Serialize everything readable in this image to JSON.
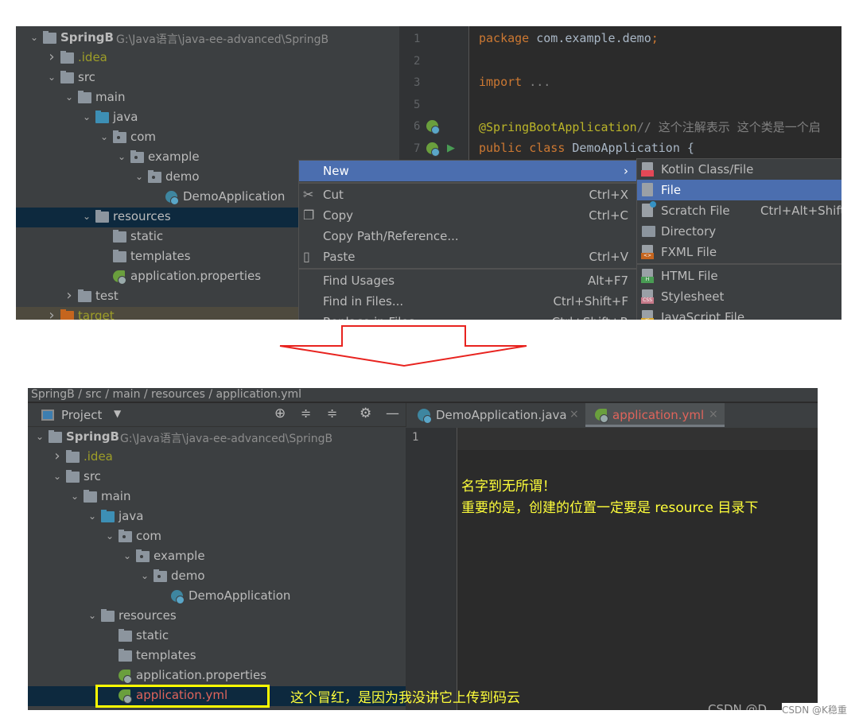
{
  "top": {
    "tree": [
      {
        "level": 0,
        "arrow": "down",
        "icon": "module",
        "label": "SpringB",
        "bold": true,
        "path": "G:\\Java语言\\java-ee-advanced\\SpringB"
      },
      {
        "level": 1,
        "arrow": "right",
        "icon": "folder",
        "label": ".idea",
        "color": "#9e9e28"
      },
      {
        "level": 1,
        "arrow": "down",
        "icon": "folder",
        "label": "src"
      },
      {
        "level": 2,
        "arrow": "down",
        "icon": "folder",
        "label": "main"
      },
      {
        "level": 3,
        "arrow": "down",
        "icon": "folder-source",
        "label": "java"
      },
      {
        "level": 4,
        "arrow": "down",
        "icon": "package",
        "label": "com"
      },
      {
        "level": 5,
        "arrow": "down",
        "icon": "package",
        "label": "example"
      },
      {
        "level": 6,
        "arrow": "down",
        "icon": "package",
        "label": "demo"
      },
      {
        "level": 7,
        "arrow": "",
        "icon": "spring-class",
        "label": "DemoApplication"
      },
      {
        "level": 3,
        "arrow": "down",
        "icon": "folder-resources",
        "label": "resources",
        "selected": true
      },
      {
        "level": 4,
        "arrow": "",
        "icon": "folder",
        "label": "static"
      },
      {
        "level": 4,
        "arrow": "",
        "icon": "folder",
        "label": "templates"
      },
      {
        "level": 4,
        "arrow": "",
        "icon": "spring-config",
        "label": "application.properties"
      },
      {
        "level": 2,
        "arrow": "right",
        "icon": "folder",
        "label": "test"
      },
      {
        "level": 1,
        "arrow": "right",
        "icon": "folder-excluded",
        "label": "target",
        "color": "#9e9e28",
        "excluded": true
      }
    ],
    "code": [
      {
        "n": "1",
        "parts": [
          [
            "kw",
            "package "
          ],
          [
            "",
            "com.example.demo"
          ],
          [
            "kw",
            ";"
          ]
        ]
      },
      {
        "n": "2",
        "parts": []
      },
      {
        "n": "3",
        "parts": [
          [
            "kw",
            "import "
          ],
          [
            "cm",
            "..."
          ]
        ]
      },
      {
        "n": "5",
        "parts": []
      },
      {
        "n": "6",
        "parts": [
          [
            "ann",
            "@SpringBootApplication"
          ],
          [
            "cm",
            "// 这个注解表示 这个类是一个启"
          ]
        ]
      },
      {
        "n": "7",
        "parts": [
          [
            "kw",
            "public class "
          ],
          [
            "",
            "DemoApplication {"
          ]
        ]
      }
    ],
    "menu": [
      {
        "label": "New",
        "shortcut": "",
        "highlighted": true,
        "submenu": true
      },
      {
        "sep": true
      },
      {
        "label": "Cut",
        "shortcut": "Ctrl+X",
        "icon": "scissors-icon"
      },
      {
        "label": "Copy",
        "shortcut": "Ctrl+C",
        "icon": "copy-icon"
      },
      {
        "label": "Copy Path/Reference...",
        "shortcut": ""
      },
      {
        "label": "Paste",
        "shortcut": "Ctrl+V",
        "icon": "paste-icon"
      },
      {
        "sep": true
      },
      {
        "label": "Find Usages",
        "shortcut": "Alt+F7"
      },
      {
        "label": "Find in Files...",
        "shortcut": "Ctrl+Shift+F"
      },
      {
        "label": "Replace in Files...",
        "shortcut": "Ctrl+Shift+R"
      }
    ],
    "submenu": [
      {
        "label": "Kotlin Class/File",
        "icon": "kotlin",
        "badge_color": "#e44857"
      },
      {
        "label": "File",
        "icon": "file",
        "highlighted": true
      },
      {
        "label": "Scratch File",
        "icon": "scratch",
        "shortcut": "Ctrl+Alt+Shift+Insert"
      },
      {
        "label": "Directory",
        "icon": "directory"
      },
      {
        "label": "FXML File",
        "icon": "fxml",
        "badge": "<>",
        "badge_color": "#c5651e"
      },
      {
        "sep": true
      },
      {
        "label": "HTML File",
        "icon": "html",
        "badge": "H",
        "badge_color": "#499c54"
      },
      {
        "label": "Stylesheet",
        "icon": "css",
        "badge": "CSS",
        "badge_color": "#c77a8a"
      },
      {
        "label": "JavaScript File",
        "icon": "js",
        "badge": "JS",
        "badge_color": "#d6a32a"
      }
    ]
  },
  "bottom": {
    "breadcrumb": "SpringB / src / main / resources / application.yml",
    "project_label": "Project",
    "tabs": [
      {
        "label": "DemoApplication.java",
        "color": "#bbbbbb"
      },
      {
        "label": "application.yml",
        "color": "#e0645b",
        "active": true
      }
    ],
    "tree": [
      {
        "level": 0,
        "arrow": "down",
        "icon": "module",
        "label": "SpringB",
        "bold": true,
        "path": "G:\\Java语言\\java-ee-advanced\\SpringB"
      },
      {
        "level": 1,
        "arrow": "right",
        "icon": "folder",
        "label": ".idea",
        "color": "#9e9e28"
      },
      {
        "level": 1,
        "arrow": "down",
        "icon": "folder",
        "label": "src"
      },
      {
        "level": 2,
        "arrow": "down",
        "icon": "folder",
        "label": "main"
      },
      {
        "level": 3,
        "arrow": "down",
        "icon": "folder-source",
        "label": "java"
      },
      {
        "level": 4,
        "arrow": "down",
        "icon": "package",
        "label": "com"
      },
      {
        "level": 5,
        "arrow": "down",
        "icon": "package",
        "label": "example"
      },
      {
        "level": 6,
        "arrow": "down",
        "icon": "package",
        "label": "demo"
      },
      {
        "level": 7,
        "arrow": "",
        "icon": "spring-class",
        "label": "DemoApplication"
      },
      {
        "level": 3,
        "arrow": "down",
        "icon": "folder-resources",
        "label": "resources"
      },
      {
        "level": 4,
        "arrow": "",
        "icon": "folder",
        "label": "static"
      },
      {
        "level": 4,
        "arrow": "",
        "icon": "folder",
        "label": "templates"
      },
      {
        "level": 4,
        "arrow": "",
        "icon": "spring-config",
        "label": "application.properties"
      },
      {
        "level": 4,
        "arrow": "",
        "icon": "spring-config",
        "label": "application.yml",
        "color": "#e0645b",
        "selected": true
      }
    ],
    "line_number": "1",
    "note_line1": "名字到无所谓！",
    "note_line2": "重要的是，创建的位置一定要是 resource 目录下",
    "red_note": "这个冒红，是因为我没讲它上传到码云",
    "watermark": "CSDN @K稳重",
    "watermark_hidden": "CSDN @D"
  },
  "colors": {
    "arrow": "#e8231f",
    "highlight_box": "#ffff00",
    "annotation": "#ffff3a"
  }
}
